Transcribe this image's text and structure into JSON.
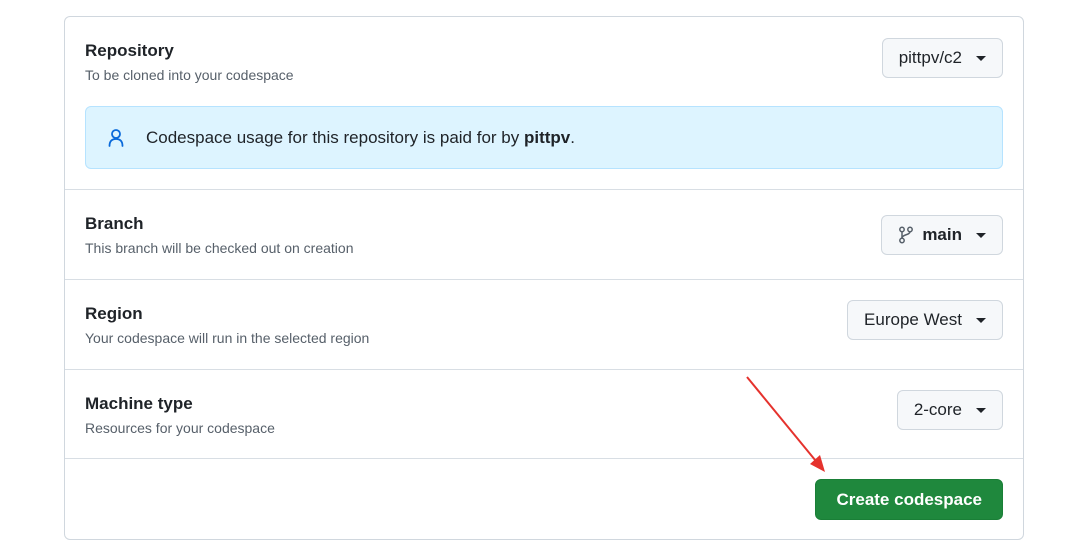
{
  "repository": {
    "title": "Repository",
    "description": "To be cloned into your codespace",
    "selected": "pittpv/c2",
    "notice_prefix": "Codespace usage for this repository is paid for by ",
    "notice_owner": "pittpv",
    "notice_suffix": ".",
    "notice_icon": "person-icon"
  },
  "branch": {
    "title": "Branch",
    "description": "This branch will be checked out on creation",
    "selected": "main",
    "icon": "git-branch-icon"
  },
  "region": {
    "title": "Region",
    "description": "Your codespace will run in the selected region",
    "selected": "Europe West"
  },
  "machine": {
    "title": "Machine type",
    "description": "Resources for your codespace",
    "selected": "2-core"
  },
  "footer": {
    "create_label": "Create codespace"
  },
  "colors": {
    "primary_button": "#1f883d",
    "notice_background": "#ddf4ff",
    "annotation_arrow": "#e5322d"
  }
}
